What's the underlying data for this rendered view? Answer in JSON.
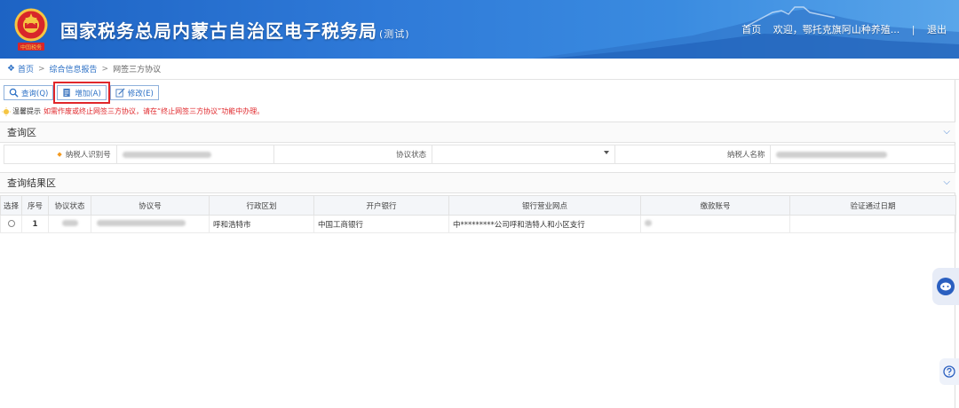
{
  "header": {
    "title": "国家税务总局内蒙古自治区电子税务局",
    "title_tag": "(测试)",
    "links": [
      "首页",
      "欢迎，鄂托克旗阿山种养殖...",
      "退出"
    ],
    "separator": "|"
  },
  "breadcrumb": {
    "home": "首页",
    "parent": "综合信息报告",
    "current": "网签三方协议",
    "arrow": ">"
  },
  "toolbar": {
    "query_label": "查询(Q)",
    "add_label": "增加(A)",
    "edit_label": "修改(E)"
  },
  "tip": {
    "label": "温馨提示",
    "text": "如需作废或终止网签三方协议，请在“终止网签三方协议”功能中办理。"
  },
  "query_panel": {
    "title": "查询区",
    "fields": {
      "taxpayer_id_label": "纳税人识别号",
      "status_label": "协议状态",
      "taxpayer_name_label": "纳税人名称"
    }
  },
  "result_panel": {
    "title": "查询结果区",
    "columns": [
      "选择",
      "序号",
      "协议状态",
      "协议号",
      "行政区划",
      "开户银行",
      "银行营业网点",
      "缴款账号",
      "验证通过日期"
    ],
    "rows": [
      {
        "seq": "1",
        "region": "呼和浩特市",
        "bank": "中国工商银行",
        "branch": "中*********公司呼和浩特人和小区支行",
        "verify_date": ""
      }
    ]
  },
  "colors": {
    "header_blue": "#2f7ad8",
    "link_blue": "#2d71c6",
    "highlight_red": "#e0262a"
  },
  "icons": {
    "query": "search-icon",
    "add": "add-document-icon",
    "edit": "edit-icon",
    "chat": "chat-icon",
    "help": "help-icon"
  }
}
